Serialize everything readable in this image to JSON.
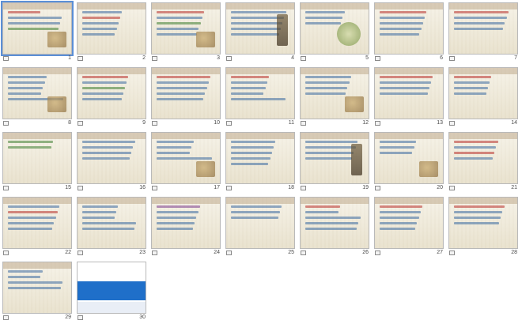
{
  "view": {
    "selected_slide": 1
  },
  "slides": [
    {
      "number": "1",
      "title": "",
      "lines": [
        "r",
        "b",
        "b",
        "g"
      ],
      "pic": "square"
    },
    {
      "number": "2",
      "title": "",
      "lines": [
        "b",
        "r",
        "b",
        "b",
        "b"
      ],
      "pic": "none"
    },
    {
      "number": "3",
      "title": "",
      "lines": [
        "r",
        "b",
        "g",
        "b",
        "b"
      ],
      "pic": "square"
    },
    {
      "number": "4",
      "title": "",
      "lines": [
        "b",
        "b",
        "b",
        "b",
        "b"
      ],
      "pic": "tall"
    },
    {
      "number": "5",
      "title": "",
      "lines": [
        "b",
        "b",
        "b"
      ],
      "pic": "round"
    },
    {
      "number": "6",
      "title": "",
      "lines": [
        "r",
        "b",
        "b",
        "b",
        "b"
      ],
      "pic": "none"
    },
    {
      "number": "7",
      "title": "",
      "lines": [
        "r",
        "b",
        "b",
        "b"
      ],
      "pic": "none"
    },
    {
      "number": "8",
      "title": "",
      "lines": [
        "b",
        "b",
        "b",
        "b",
        "b"
      ],
      "pic": "square"
    },
    {
      "number": "9",
      "title": "",
      "lines": [
        "r",
        "b",
        "g",
        "b",
        "b"
      ],
      "pic": "none"
    },
    {
      "number": "10",
      "title": "",
      "lines": [
        "r",
        "b",
        "b",
        "b",
        "b"
      ],
      "pic": "none"
    },
    {
      "number": "11",
      "title": "",
      "lines": [
        "r",
        "b",
        "b",
        "b",
        "b"
      ],
      "pic": "none"
    },
    {
      "number": "12",
      "title": "",
      "lines": [
        "b",
        "b",
        "b",
        "b"
      ],
      "pic": "square"
    },
    {
      "number": "13",
      "title": "",
      "lines": [
        "r",
        "b",
        "b",
        "b"
      ],
      "pic": "none"
    },
    {
      "number": "14",
      "title": "",
      "lines": [
        "r",
        "b",
        "b",
        "b"
      ],
      "pic": "none"
    },
    {
      "number": "15",
      "title": "",
      "lines": [
        "g",
        "g"
      ],
      "pic": "none"
    },
    {
      "number": "16",
      "title": "",
      "lines": [
        "b",
        "b",
        "b",
        "b"
      ],
      "pic": "none"
    },
    {
      "number": "17",
      "title": "",
      "lines": [
        "b",
        "b",
        "b",
        "b"
      ],
      "pic": "square"
    },
    {
      "number": "18",
      "title": "",
      "lines": [
        "b",
        "b",
        "b",
        "b",
        "b"
      ],
      "pic": "none"
    },
    {
      "number": "19",
      "title": "",
      "lines": [
        "b",
        "b",
        "b",
        "b"
      ],
      "pic": "tall"
    },
    {
      "number": "20",
      "title": "",
      "lines": [
        "b",
        "b",
        "b"
      ],
      "pic": "square"
    },
    {
      "number": "21",
      "title": "",
      "lines": [
        "r",
        "b",
        "r",
        "b"
      ],
      "pic": "none"
    },
    {
      "number": "22",
      "title": "",
      "lines": [
        "b",
        "r",
        "b",
        "b",
        "b"
      ],
      "pic": "none"
    },
    {
      "number": "23",
      "title": "",
      "lines": [
        "b",
        "b",
        "b",
        "b",
        "b"
      ],
      "pic": "none"
    },
    {
      "number": "24",
      "title": "",
      "lines": [
        "p",
        "b",
        "b",
        "b",
        "b"
      ],
      "pic": "none"
    },
    {
      "number": "25",
      "title": "",
      "lines": [
        "b",
        "b",
        "b"
      ],
      "pic": "none"
    },
    {
      "number": "26",
      "title": "",
      "lines": [
        "r",
        "b",
        "b",
        "b",
        "b"
      ],
      "pic": "none"
    },
    {
      "number": "27",
      "title": "",
      "lines": [
        "r",
        "b",
        "b",
        "b",
        "b"
      ],
      "pic": "none"
    },
    {
      "number": "28",
      "title": "",
      "lines": [
        "r",
        "b",
        "b",
        "b"
      ],
      "pic": "none"
    },
    {
      "number": "29",
      "title": "",
      "lines": [
        "b",
        "b",
        "b",
        "b"
      ],
      "pic": "none"
    },
    {
      "number": "30",
      "title": "",
      "lines": [],
      "pic": "ad"
    }
  ]
}
